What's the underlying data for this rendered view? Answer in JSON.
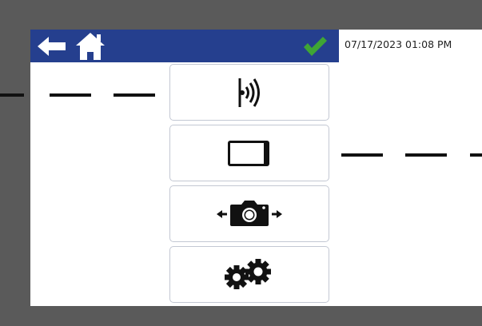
{
  "header": {
    "datetime": "07/17/2023 01:08 PM",
    "back_icon": "arrow-left-icon",
    "home_icon": "home-icon",
    "status_icon": "checkmark-icon",
    "status_color": "#3fa535",
    "bar_color": "#253f8e"
  },
  "menu": {
    "items": [
      {
        "icon": "signal-waves-icon"
      },
      {
        "icon": "display-panel-icon"
      },
      {
        "icon": "camera-move-icon"
      },
      {
        "icon": "gears-icon"
      }
    ]
  }
}
